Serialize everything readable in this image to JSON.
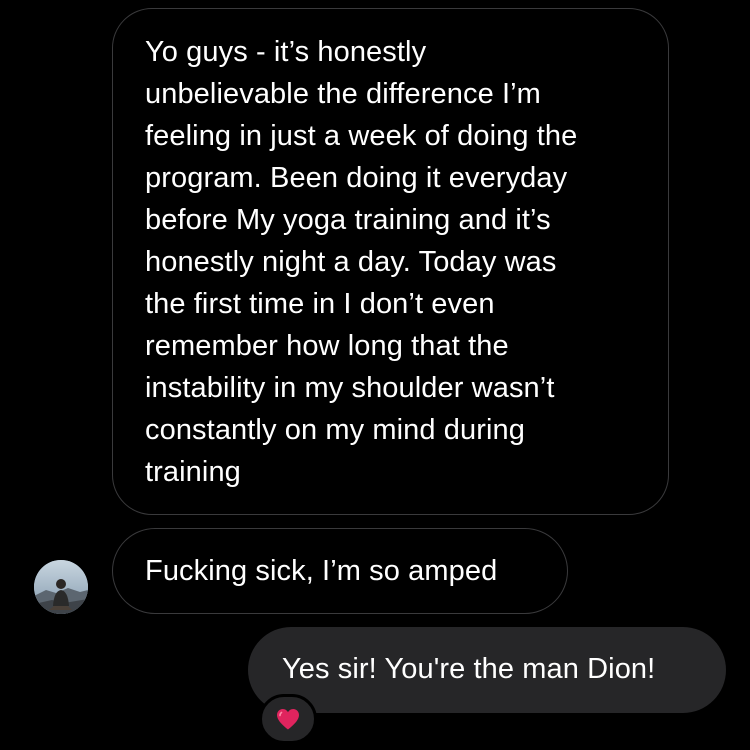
{
  "messages": [
    {
      "direction": "incoming",
      "text": "Yo guys - it’s honestly\nunbelievable the difference I’m\nfeeling in just a week of doing the\nprogram. Been doing it everyday\nbefore My yoga training and it’s\nhonestly night a day. Today was\nthe first time in I don’t even\nremember how long that the\ninstability in my shoulder wasn’t\nconstantly on my mind during\ntraining"
    },
    {
      "direction": "incoming",
      "text": "Fucking sick, I’m so amped",
      "avatar_icon": "user-avatar-photo"
    },
    {
      "direction": "outgoing",
      "text": "Yes sir! You're the man Dion!",
      "reaction": "red-heart"
    }
  ],
  "colors": {
    "background": "#000000",
    "incoming_border": "#3a3a3c",
    "outgoing_bubble": "#262628",
    "text": "#ffffff",
    "heart": "#e0245e"
  }
}
